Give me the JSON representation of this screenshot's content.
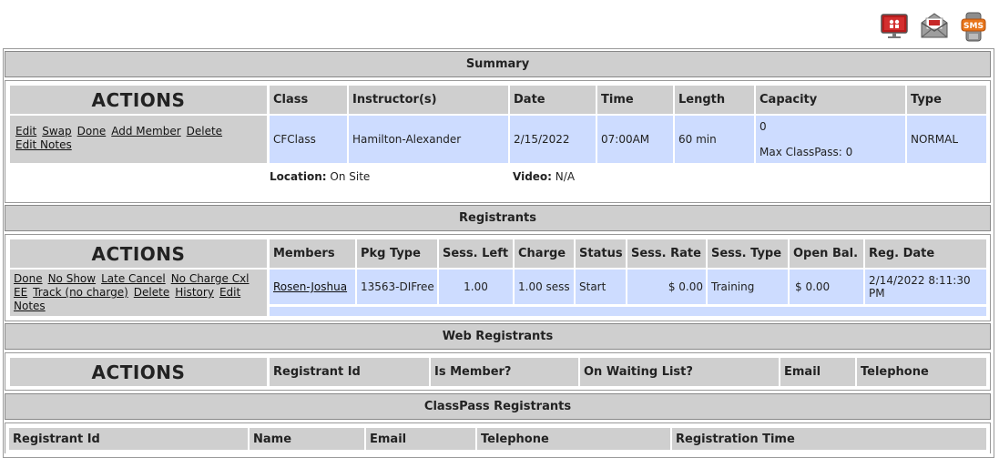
{
  "top_icons": [
    "presentation-icon",
    "email-icon",
    "sms-icon"
  ],
  "top_icon_labels": {
    "sms": "SMS"
  },
  "summary": {
    "title": "Summary",
    "actions_header": "ACTIONS",
    "headers": [
      "Class",
      "Instructor(s)",
      "Date",
      "Time",
      "Length",
      "Capacity",
      "Type"
    ],
    "actions": [
      "Edit",
      "Swap",
      "Done",
      "Add Member",
      "Delete",
      "Edit Notes"
    ],
    "row": {
      "class": "CFClass",
      "instructor": "Hamilton-Alexander",
      "date": "2/15/2022",
      "time": "07:00AM",
      "length": "60 min",
      "capacity": "0",
      "max_classpass": "Max ClassPass: 0",
      "type": "NORMAL"
    },
    "location_label": "Location:",
    "location_value": "On Site",
    "video_label": "Video:",
    "video_value": "N/A"
  },
  "registrants": {
    "title": "Registrants",
    "actions_header": "ACTIONS",
    "headers": [
      "Members",
      "Pkg Type",
      "Sess. Left",
      "Charge",
      "Status",
      "Sess. Rate",
      "Sess. Type",
      "Open Bal.",
      "Reg. Date"
    ],
    "actions": [
      "Done",
      "No Show",
      "Late Cancel",
      "No Charge Cxl",
      "EE",
      "Track (no charge)",
      "Delete",
      "History",
      "Edit",
      "Notes"
    ],
    "row": {
      "member": "Rosen-Joshua",
      "pkg_type": "13563-DIFree",
      "sess_left": "1.00",
      "charge": "1.00 sess",
      "status": "Start",
      "sess_rate": "$ 0.00",
      "sess_type": "Training",
      "open_bal": "$ 0.00",
      "reg_date": "2/14/2022 8:11:30 PM"
    }
  },
  "web_registrants": {
    "title": "Web Registrants",
    "actions_header": "ACTIONS",
    "headers": [
      "Registrant Id",
      "Is Member?",
      "On Waiting List?",
      "Email",
      "Telephone"
    ]
  },
  "classpass_registrants": {
    "title": "ClassPass Registrants",
    "headers": [
      "Registrant Id",
      "Name",
      "Email",
      "Telephone",
      "Registration Time"
    ]
  },
  "colors": {
    "header_gray": "#cfcfcf",
    "data_blue": "#cddcff",
    "sms_orange": "#e8751a",
    "email_red": "#c62828"
  }
}
